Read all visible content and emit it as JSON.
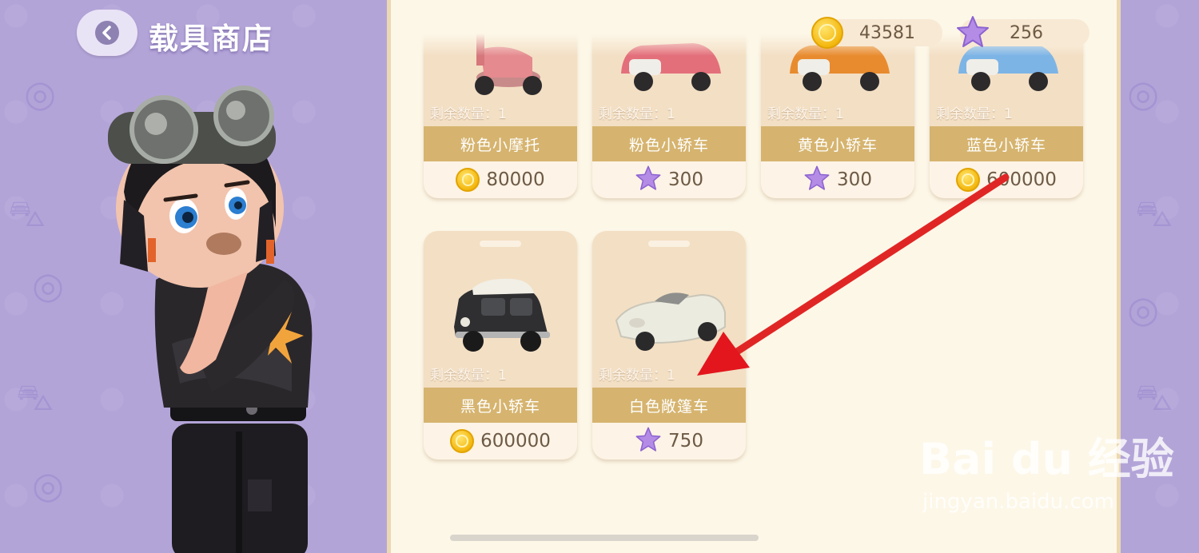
{
  "header": {
    "title": "载具商店"
  },
  "currency": {
    "coins": "43581",
    "stars": "256",
    "add_label": "+"
  },
  "shop": {
    "quantity_label": "剩余数量：1",
    "items": [
      {
        "name": "粉色小摩托",
        "price": "80000",
        "currency": "coin",
        "image": "pink-scooter"
      },
      {
        "name": "粉色小轿车",
        "price": "300",
        "currency": "star",
        "image": "pink-car"
      },
      {
        "name": "黄色小轿车",
        "price": "300",
        "currency": "star",
        "image": "orange-car"
      },
      {
        "name": "蓝色小轿车",
        "price": "600000",
        "currency": "coin",
        "image": "blue-car"
      },
      {
        "name": "黑色小轿车",
        "price": "600000",
        "currency": "coin",
        "image": "black-car"
      },
      {
        "name": "白色敞篷车",
        "price": "750",
        "currency": "star",
        "image": "white-convertible"
      }
    ]
  },
  "watermark": {
    "brand": "Bai du 经验",
    "url": "jingyan.baidu.com"
  },
  "colors": {
    "background": "#b3a4d8",
    "panel": "#fdf7e8",
    "name_bar": "#d6b46f",
    "arrow": "#e02020"
  }
}
